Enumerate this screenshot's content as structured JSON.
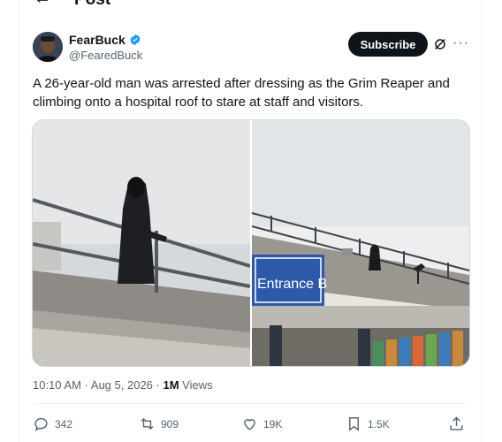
{
  "header": {
    "back_icon": "arrow-left-icon",
    "title": "Post"
  },
  "author": {
    "name": "FearBuck",
    "handle": "@FearedBuck",
    "verified_icon": "verified-badge-icon",
    "verified_color": "#1d9bf0"
  },
  "subscribe_label": "Subscribe",
  "tweet": {
    "text": "A 26-year-old man was arrested after dressing as the Grim Reaper and climbing onto a hospital roof to stare at staff and visitors."
  },
  "media": {
    "sign_text": "Entrance B"
  },
  "meta": {
    "time": "10:10 AM",
    "date": "Aug 5, 2026",
    "views_count": "1M",
    "views_label": "Views"
  },
  "actions": {
    "replies": "342",
    "reposts": "909",
    "likes": "19K",
    "bookmarks": "1.5K"
  },
  "colors": {
    "text": "#0f1419",
    "secondary": "#536471",
    "accent": "#1d9bf0",
    "border": "#eff3f4"
  }
}
